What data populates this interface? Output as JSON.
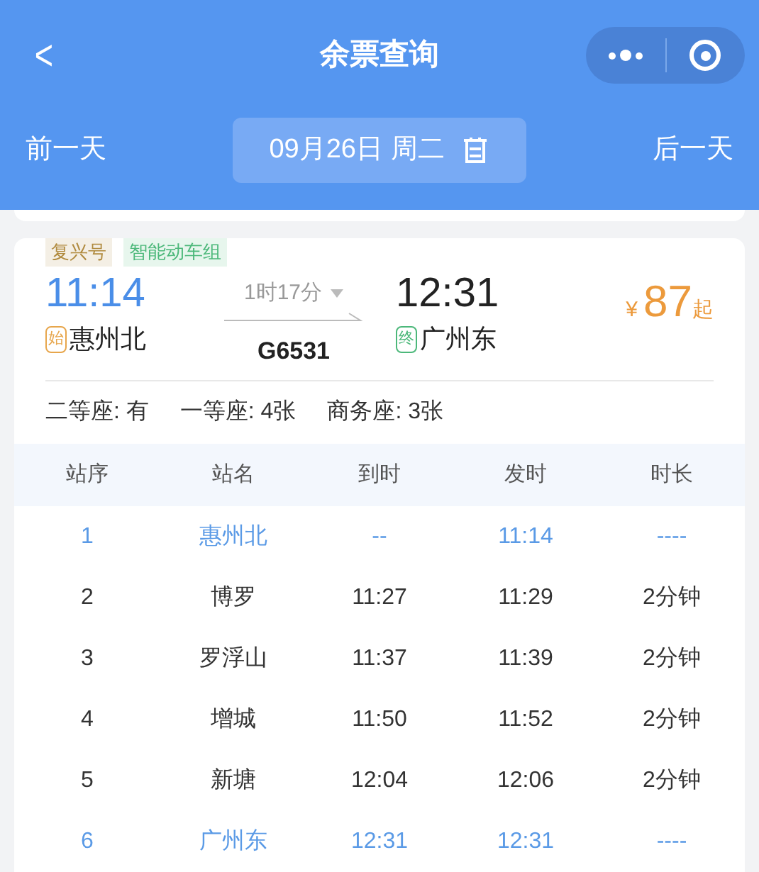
{
  "nav": {
    "back": "<",
    "title": "余票查询"
  },
  "date_bar": {
    "prev": "前一天",
    "date": "09月26日 周二",
    "next": "后一天"
  },
  "train": {
    "tags": [
      {
        "label": "复兴号",
        "color": "#b08a3e"
      },
      {
        "label": "智能动车组",
        "color": "#4cb87a"
      }
    ],
    "depart_time": "11:14",
    "depart_badge": "始",
    "depart_station": "惠州北",
    "duration": "1时17分",
    "number": "G6531",
    "arrive_time": "12:31",
    "arrive_badge": "终",
    "arrive_station": "广州东",
    "currency": "¥",
    "price": "87",
    "price_suffix": "起",
    "seats": [
      "二等座: 有",
      "一等座: 4张",
      "商务座: 3张"
    ]
  },
  "table": {
    "columns": [
      "站序",
      "站名",
      "到时",
      "发时",
      "时长"
    ],
    "rows": [
      {
        "cells": [
          "1",
          "惠州北",
          "--",
          "11:14",
          "----"
        ],
        "highlighted": true
      },
      {
        "cells": [
          "2",
          "博罗",
          "11:27",
          "11:29",
          "2分钟"
        ],
        "highlighted": false
      },
      {
        "cells": [
          "3",
          "罗浮山",
          "11:37",
          "11:39",
          "2分钟"
        ],
        "highlighted": false
      },
      {
        "cells": [
          "4",
          "增城",
          "11:50",
          "11:52",
          "2分钟"
        ],
        "highlighted": false
      },
      {
        "cells": [
          "5",
          "新塘",
          "12:04",
          "12:06",
          "2分钟"
        ],
        "highlighted": false
      },
      {
        "cells": [
          "6",
          "广州东",
          "12:31",
          "12:31",
          "----"
        ],
        "highlighted": true
      }
    ]
  }
}
